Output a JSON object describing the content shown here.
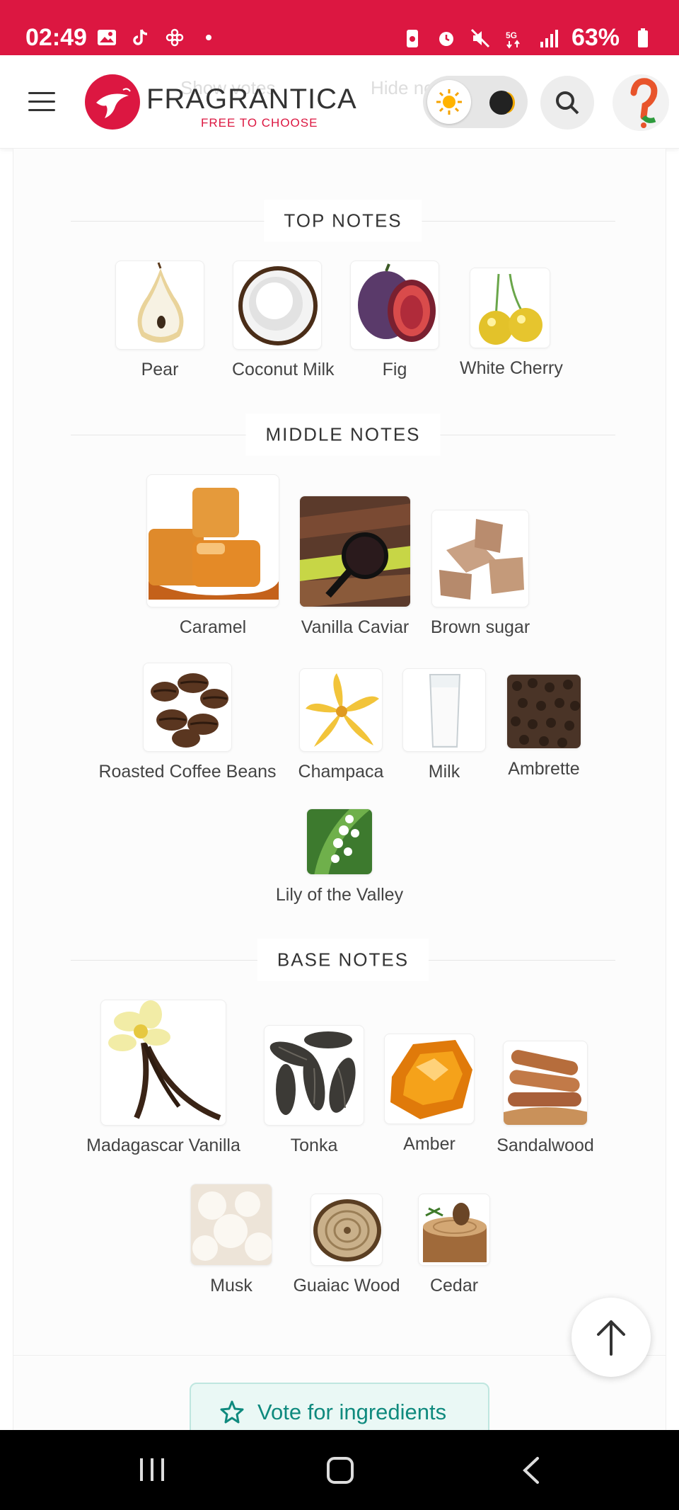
{
  "status_bar": {
    "time": "02:49",
    "battery": "63%",
    "network": "5G"
  },
  "header": {
    "logo_title": "FRAGRANTICA",
    "logo_subtitle": "FREE TO CHOOSE",
    "ghost_left": "Show votes",
    "ghost_right": "Hide notes"
  },
  "sections": {
    "top": {
      "title": "TOP NOTES",
      "items": [
        "Pear",
        "Coconut Milk",
        "Fig",
        "White Cherry"
      ]
    },
    "middle": {
      "title": "MIDDLE NOTES",
      "items": [
        "Caramel",
        "Vanilla Caviar",
        "Brown sugar",
        "Roasted Coffee Beans",
        "Champaca",
        "Milk",
        "Ambrette",
        "Lily of the Valley"
      ]
    },
    "base": {
      "title": "BASE NOTES",
      "items": [
        "Madagascar Vanilla",
        "Tonka",
        "Amber",
        "Sandalwood",
        "Musk",
        "Guaiac Wood",
        "Cedar"
      ]
    }
  },
  "vote_button": {
    "label": "Vote for ingredients"
  },
  "colors": {
    "brand": "#dc1741",
    "teal": "#0f8a7e"
  },
  "icons": {
    "menu": "hamburger-icon",
    "search": "search-icon",
    "theme_light": "sun-icon",
    "theme_dark": "moon-icon",
    "scroll_top": "arrow-up-icon",
    "vote": "star-icon"
  }
}
